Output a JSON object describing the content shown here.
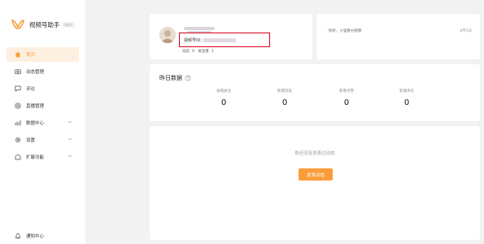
{
  "brand": {
    "title": "视频号助手",
    "badge": "beta",
    "accent": "#fa9d3b"
  },
  "sidebar": {
    "items": [
      {
        "label": "首页",
        "icon": "home-icon",
        "active": true,
        "chevron": false
      },
      {
        "label": "动态管理",
        "icon": "camera-icon",
        "active": false,
        "chevron": false
      },
      {
        "label": "评论",
        "icon": "comment-icon",
        "active": false,
        "chevron": false
      },
      {
        "label": "直播管理",
        "icon": "live-icon",
        "active": false,
        "chevron": false
      },
      {
        "label": "数据中心",
        "icon": "chart-icon",
        "active": false,
        "chevron": true
      },
      {
        "label": "设置",
        "icon": "gear-icon",
        "active": false,
        "chevron": true
      },
      {
        "label": "扩展功能",
        "icon": "extension-icon",
        "active": false,
        "chevron": true
      }
    ],
    "bottom": {
      "label": "通知中心",
      "icon": "bell-icon"
    }
  },
  "profile": {
    "video_id_label": "视频号ID:",
    "posts_label": "动态",
    "posts_count": "0",
    "following_label": "关注者",
    "following_count": "1",
    "highlight_color": "#d9001b"
  },
  "notice": {
    "text": "· 你好，十里春分视频",
    "date": "8月5日"
  },
  "yesterday": {
    "title": "昨日数据",
    "stats": [
      {
        "label": "净增关注",
        "value": "0"
      },
      {
        "label": "新增浏览",
        "value": "0"
      },
      {
        "label": "新增点赞",
        "value": "0"
      },
      {
        "label": "新增评论",
        "value": "0"
      }
    ]
  },
  "empty_state": {
    "text": "你还没有发表过动态",
    "button_label": "发表动态"
  }
}
